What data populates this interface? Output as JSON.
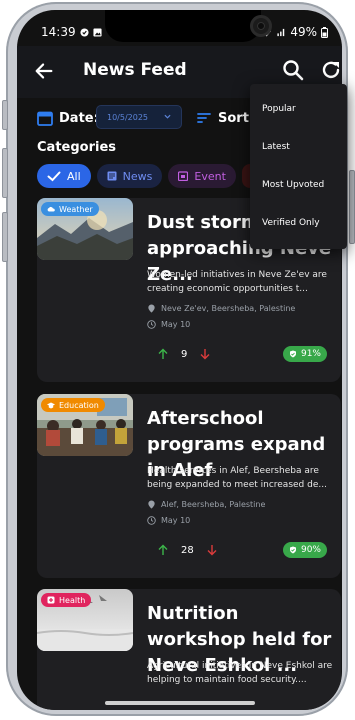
{
  "status": {
    "time": "14:39",
    "battery": "49%"
  },
  "header": {
    "title": "News Feed"
  },
  "filters": {
    "date_label": "Date:",
    "date_value": "10/5/2025",
    "sort_label": "Sort:"
  },
  "categories": {
    "title": "Categories",
    "chips": [
      {
        "label": "All"
      },
      {
        "label": "News"
      },
      {
        "label": "Event"
      }
    ]
  },
  "sort_menu": {
    "items": [
      {
        "label": "Popular"
      },
      {
        "label": "Latest"
      },
      {
        "label": "Most Upvoted"
      },
      {
        "label": "Verified Only"
      }
    ]
  },
  "feed": [
    {
      "badge": "Weather",
      "title": "Dust storm approaching Neve Ze...",
      "description": "Women-led initiatives in Neve Ze'ev are creating economic opportunities t...",
      "location": "Neve Ze'ev, Beersheba, Palestine",
      "date": "May 10",
      "upvotes": "9",
      "verified_pct": "91%"
    },
    {
      "badge": "Education",
      "title": "Afterschool programs expand in Alef",
      "description": "Health services in Alef, Beersheba are being expanded to meet increased de...",
      "location": "Alef, Beersheba, Palestine",
      "date": "May 10",
      "upvotes": "28",
      "verified_pct": "90%"
    },
    {
      "badge": "Health",
      "title": "Nutrition workshop held for Neve Eshkol ...",
      "description": "Agricultural initiatives in Neve Eshkol are helping to maintain food security....",
      "location": "",
      "date": "",
      "upvotes": "",
      "verified_pct": ""
    }
  ],
  "colors": {
    "accent": "#2b66e6",
    "weather_badge": "#3a8fe0",
    "education_badge": "#f08a00",
    "health_badge": "#e0245e",
    "verified": "#38a84a",
    "upvote": "#3cb54a",
    "downvote": "#d93b3b"
  }
}
